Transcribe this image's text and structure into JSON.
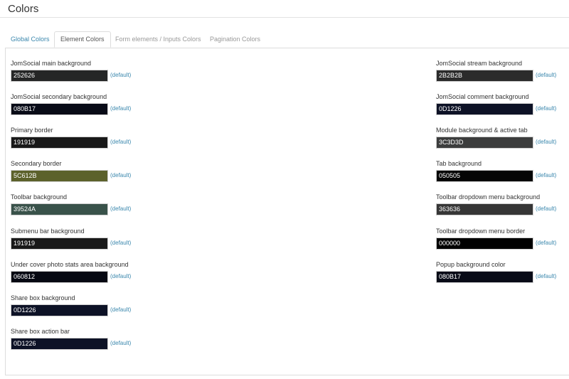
{
  "page": {
    "title": "Colors"
  },
  "tabs": [
    {
      "label": "Global Colors",
      "state": "inactive"
    },
    {
      "label": "Element Colors",
      "state": "active"
    },
    {
      "label": "Form elements / Inputs Colors",
      "state": "disabled"
    },
    {
      "label": "Pagination Colors",
      "state": "disabled"
    }
  ],
  "default_label": "(default)",
  "left_fields": [
    {
      "label": "JomSocial main background",
      "value": "252626",
      "color": "#252626"
    },
    {
      "label": "JomSocial secondary background",
      "value": "080B17",
      "color": "#080B17"
    },
    {
      "label": "Primary border",
      "value": "191919",
      "color": "#191919"
    },
    {
      "label": "Secondary border",
      "value": "5C612B",
      "color": "#5C612B"
    },
    {
      "label": "Toolbar background",
      "value": "39524A",
      "color": "#39524A"
    },
    {
      "label": "Submenu bar background",
      "value": "191919",
      "color": "#191919"
    },
    {
      "label": "Under cover photo stats area background",
      "value": "060812",
      "color": "#060812"
    },
    {
      "label": "Share box background",
      "value": "0D1226",
      "color": "#0D1226"
    },
    {
      "label": "Share box action bar",
      "value": "0D1226",
      "color": "#0D1226"
    }
  ],
  "right_fields": [
    {
      "label": "JomSocial stream background",
      "value": "2B2B2B",
      "color": "#2B2B2B"
    },
    {
      "label": "JomSocial comment background",
      "value": "0D1226",
      "color": "#0D1226"
    },
    {
      "label": "Module background & active tab",
      "value": "3C3D3D",
      "color": "#3C3D3D"
    },
    {
      "label": "Tab background",
      "value": "050505",
      "color": "#050505"
    },
    {
      "label": "Toolbar dropdown menu background",
      "value": "363636",
      "color": "#363636"
    },
    {
      "label": "Toolbar dropdown menu border",
      "value": "000000",
      "color": "#000000"
    },
    {
      "label": "Popup background color",
      "value": "080B17",
      "color": "#080B17"
    }
  ]
}
